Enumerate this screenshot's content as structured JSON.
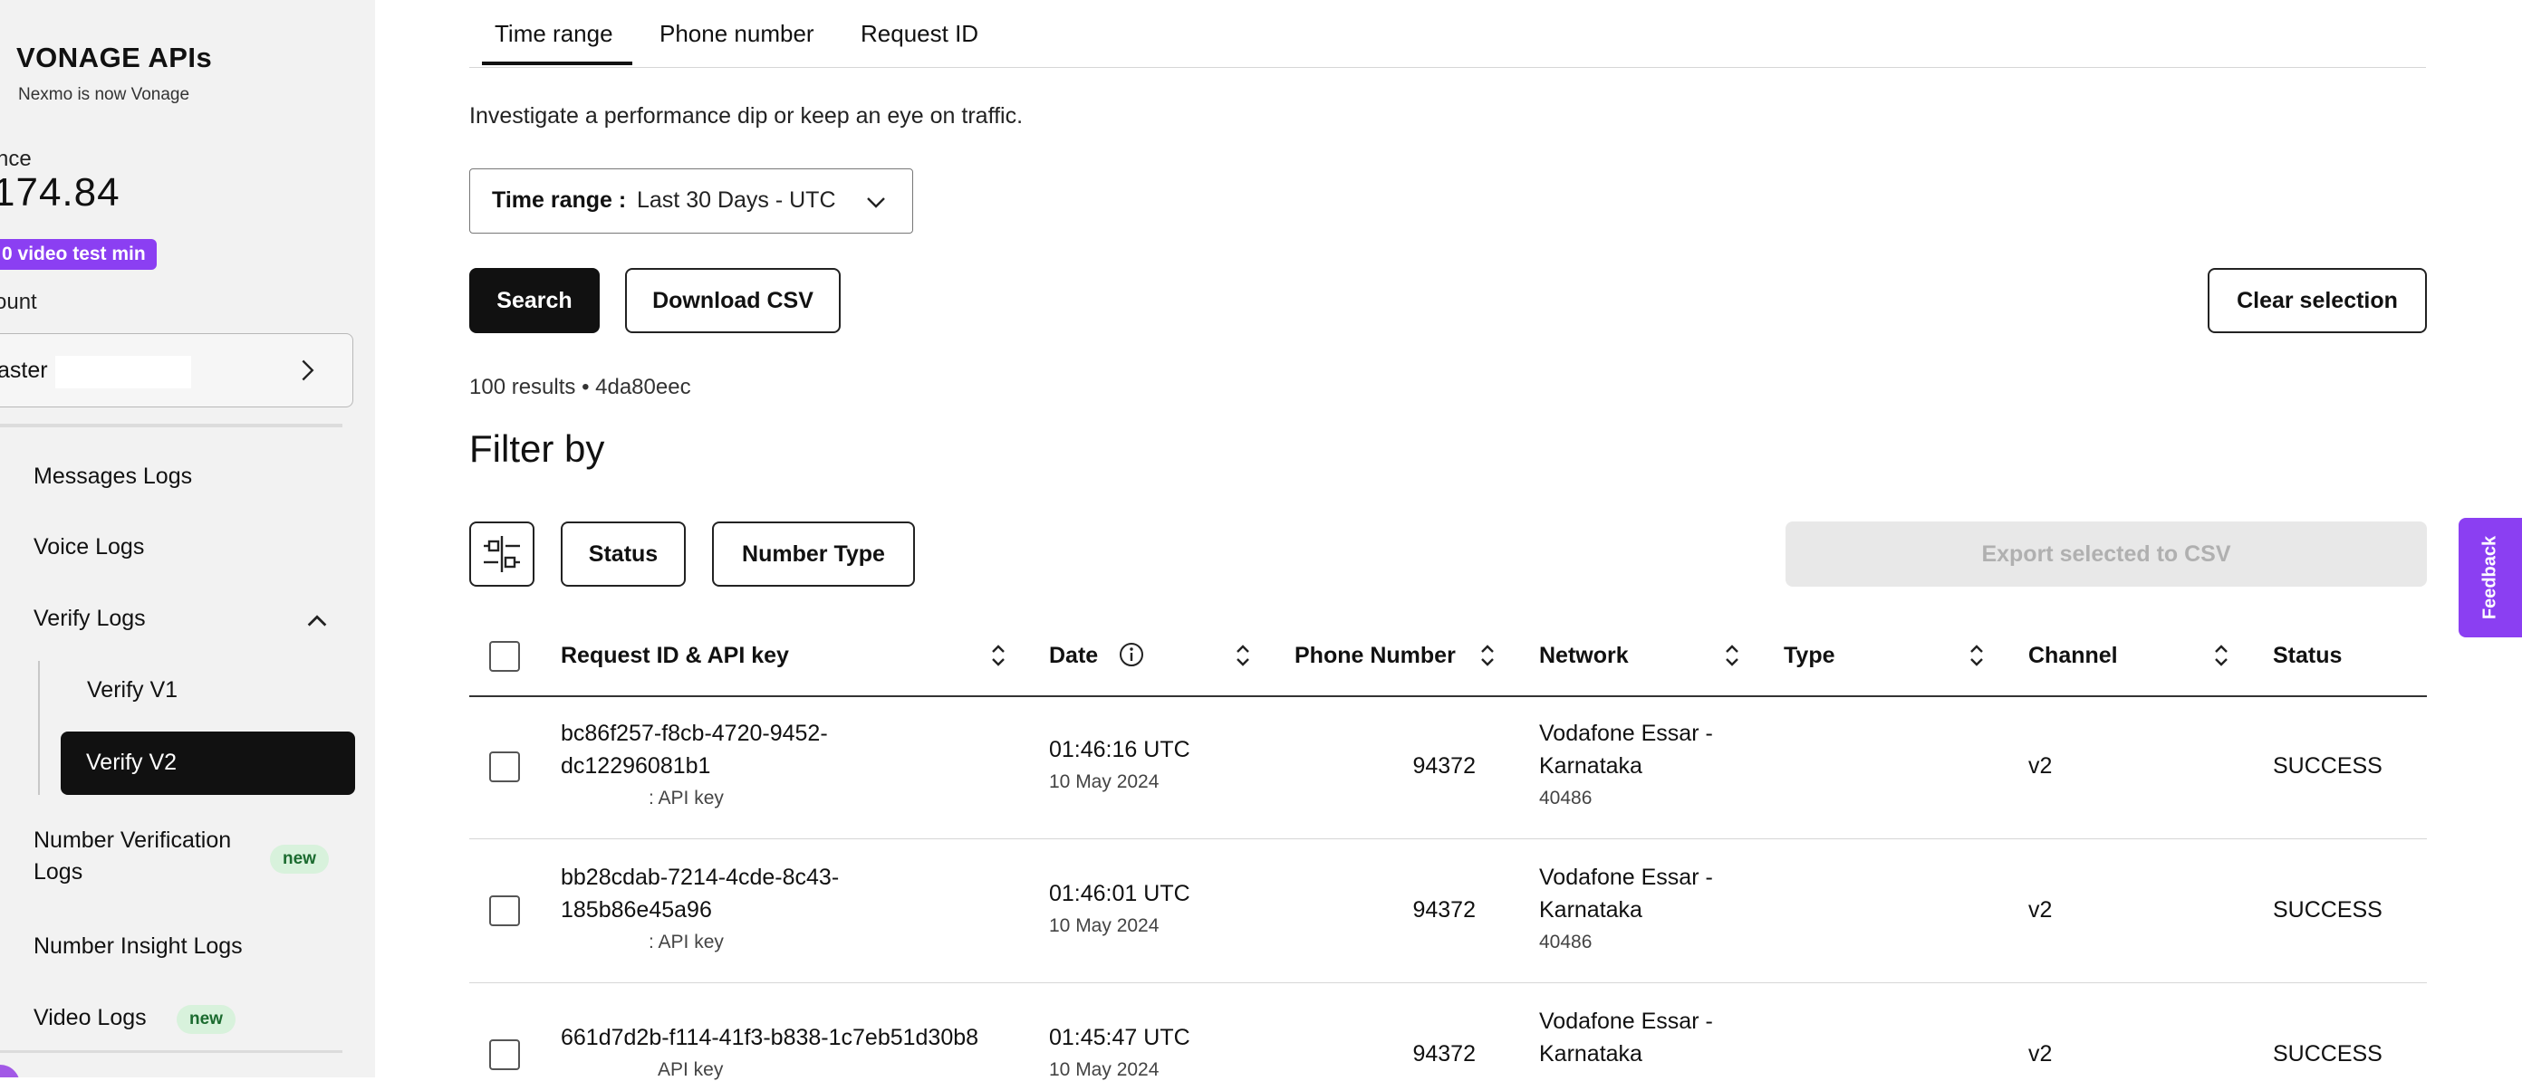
{
  "sidebar": {
    "brand": "VONAGE APIs",
    "brand_sub": "Nexmo is now Vonage",
    "balance_label": "nce",
    "balance_amount": "174.84",
    "promo_badge": "0 video test min",
    "account_label": "ount",
    "account_name": "aster",
    "nav": {
      "messages_logs": "Messages Logs",
      "voice_logs": "Voice Logs",
      "verify_logs": "Verify Logs",
      "verify_v1": "Verify V1",
      "verify_v2": "Verify V2",
      "number_verification_logs_1": "Number Verification",
      "number_verification_logs_2": "Logs",
      "number_insight_logs": "Number Insight Logs",
      "video_logs": "Video Logs",
      "new_badge": "new"
    }
  },
  "tabs": [
    "Time range",
    "Phone number",
    "Request ID"
  ],
  "description": "Investigate a performance dip or keep an eye on traffic.",
  "time_range": {
    "label": "Time range :",
    "value": "Last 30 Days - UTC"
  },
  "buttons": {
    "search": "Search",
    "download_csv": "Download CSV",
    "clear_selection": "Clear selection",
    "export_selected": "Export selected to CSV"
  },
  "results_summary": "100 results • 4da80eec",
  "filter": {
    "title": "Filter by",
    "status": "Status",
    "number_type": "Number Type"
  },
  "table": {
    "headers": {
      "request_id": "Request ID & API key",
      "date": "Date",
      "phone_number": "Phone Number",
      "network": "Network",
      "type": "Type",
      "channel": "Channel",
      "status": "Status"
    },
    "rows": [
      {
        "id_line1": "bc86f257-f8cb-4720-9452-",
        "id_line2": "dc12296081b1",
        "api_key": ": API key",
        "time": "01:46:16 UTC",
        "date": "10 May 2024",
        "phone": "94372",
        "network_line1": "Vodafone Essar -",
        "network_line2": "Karnataka",
        "network_code": "40486",
        "channel": "v2",
        "status": "SUCCESS"
      },
      {
        "id_line1": "bb28cdab-7214-4cde-8c43-",
        "id_line2": "185b86e45a96",
        "api_key": ": API key",
        "time": "01:46:01 UTC",
        "date": "10 May 2024",
        "phone": "94372",
        "network_line1": "Vodafone Essar -",
        "network_line2": "Karnataka",
        "network_code": "40486",
        "channel": "v2",
        "status": "SUCCESS"
      },
      {
        "id_line1": "661d7d2b-f114-41f3-b838-1c7eb51d30b8",
        "id_line2": "",
        "api_key": "API key",
        "time": "01:45:47 UTC",
        "date": "10 May 2024",
        "phone": "94372",
        "network_line1": "Vodafone Essar -",
        "network_line2": "Karnataka",
        "network_code": "",
        "channel": "v2",
        "status": "SUCCESS"
      }
    ]
  },
  "feedback": "Feedback",
  "colors": {
    "brand_purple": "#8b3ff2",
    "new_badge_bg": "#d8f2dc",
    "new_badge_text": "#1b6b2f"
  }
}
